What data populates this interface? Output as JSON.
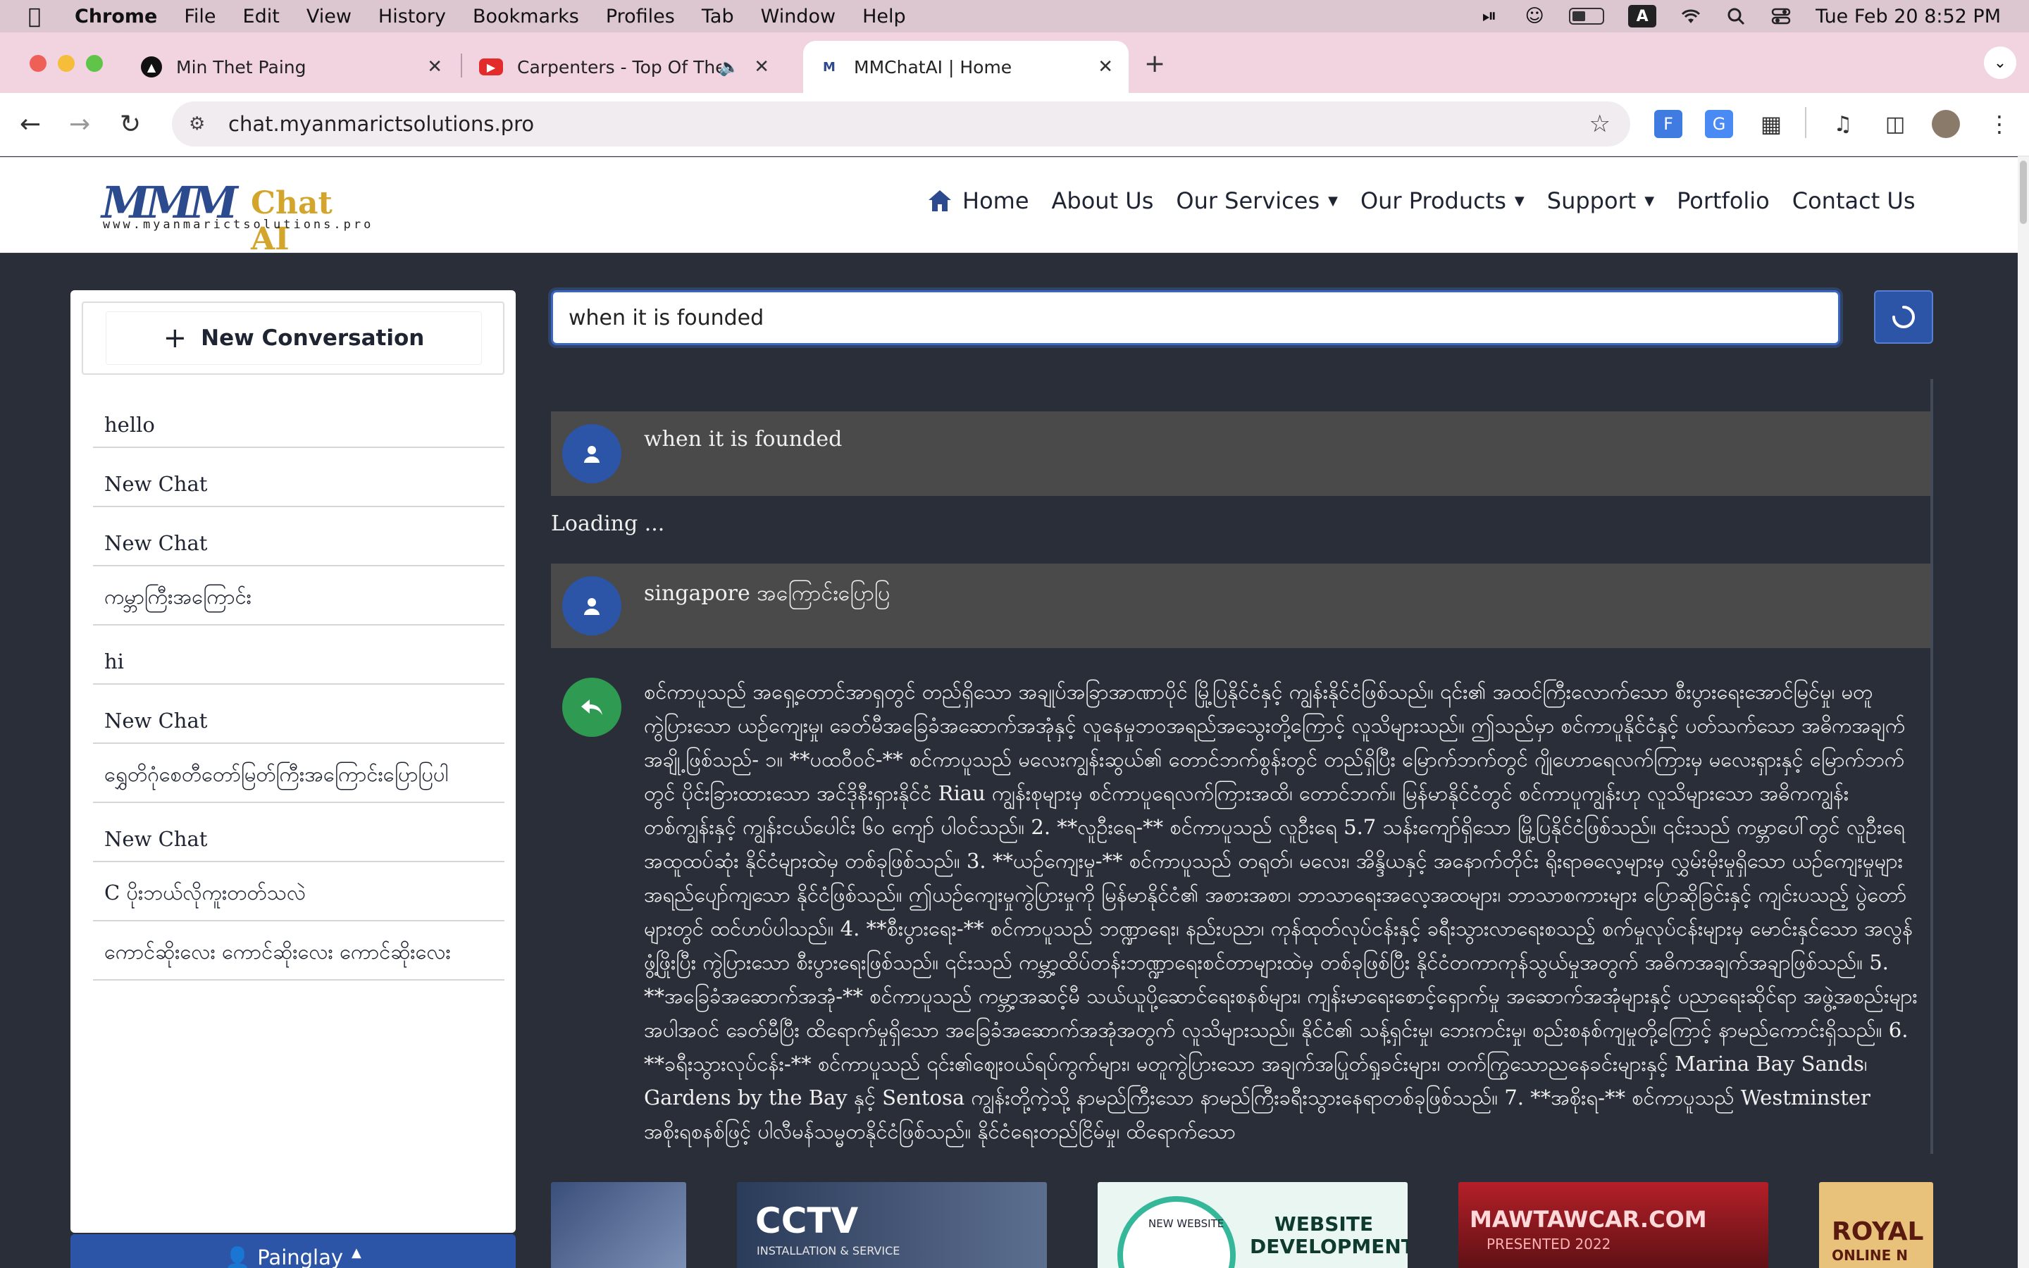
{
  "menubar": {
    "app": "Chrome",
    "items": [
      "File",
      "Edit",
      "View",
      "History",
      "Bookmarks",
      "Profiles",
      "Tab",
      "Window",
      "Help"
    ],
    "datetime": "Tue Feb 20  8:52 PM",
    "input_source": "A"
  },
  "tabs": [
    {
      "title": "Min Thet Paing"
    },
    {
      "title": "Carpenters - Top Of The W"
    },
    {
      "title": "MMChatAI | Home"
    }
  ],
  "browser": {
    "url": "chat.myanmarictsolutions.pro"
  },
  "site": {
    "logo_mark": "MMM",
    "logo_chat": "Chat AI",
    "logo_url": "www.myanmarictsolutions.pro",
    "nav": [
      {
        "label": "Home"
      },
      {
        "label": "About Us"
      },
      {
        "label": "Our Services"
      },
      {
        "label": "Our Products"
      },
      {
        "label": "Support"
      },
      {
        "label": "Portfolio"
      },
      {
        "label": "Contact Us"
      }
    ]
  },
  "sidebar": {
    "new_conversation_label": "New Conversation",
    "conversations": [
      "hello",
      "New Chat",
      "New Chat",
      "ကမ္ဘာကြီးအကြောင်း",
      "hi",
      "New Chat",
      "ရွှေတိဂုံစေတီတော်မြတ်ကြီးအကြောင်းပြောပြပါ",
      "New Chat",
      "C ပိုးဘယ်လိုကူးတတ်သလဲ",
      "ကောင်ဆိုးလေး ကောင်ဆိုးလေး ကောင်ဆိုးလေး"
    ],
    "user_name": "Painglay"
  },
  "chat": {
    "input_value": "when it is founded",
    "messages": [
      {
        "role": "user",
        "text": "when it is founded"
      },
      {
        "role": "status",
        "text": "Loading ..."
      },
      {
        "role": "user",
        "text": "singapore အကြောင်းပြောပြ"
      },
      {
        "role": "bot",
        "text": "စင်ကာပူသည် အရှေ့တောင်အာရှတွင် တည်ရှိသော အချုပ်အခြာအာဏာပိုင် မြို့ပြနိုင်ငံနှင့် ကျွန်းနိုင်ငံဖြစ်သည်။ ၎င်း၏ အထင်ကြီးလောက်သော စီးပွားရေးအောင်မြင်မှု၊ မတူကွဲပြားသော ယဉ်ကျေးမှု၊ ခေတ်မီအခြေခံအဆောက်အအုံနှင့် လူနေမှုဘဝအရည်အသွေးတို့ကြောင့် လူသိများသည်။ ဤသည်မှာ စင်ကာပူနိုင်ငံနှင့် ပတ်သက်သော အဓိကအချက်အချို့ဖြစ်သည်- ၁။ **ပထဝီဝင်-** စင်ကာပူသည် မလေးကျွန်းဆွယ်၏ တောင်ဘက်စွန်းတွင် တည်ရှိပြီး မြောက်ဘက်တွင် ဂျိုဟောရေလက်ကြားမှ မလေးရှားနှင့် မြောက်ဘက်တွင် ပိုင်းခြားထားသော အင်ဒိုနီးရှားနိုင်ငံ Riau ကျွန်းစုများမှ စင်ကာပူရေလက်ကြားအထိ၊ တောင်ဘက်။ မြန်မာနိုင်ငံတွင် စင်ကာပူကျွန်းဟု လူသိများသော အဓိကကျွန်းတစ်ကျွန်းနှင့် ကျွန်းငယ်ပေါင်း ၆၀ ကျော် ပါဝင်သည်။ 2. **လူဦးရေ-** စင်ကာပူသည် လူဦးရေ 5.7 သန်းကျော်ရှိသော မြို့ပြနိုင်ငံဖြစ်သည်။ ၎င်းသည် ကမ္ဘာပေါ်တွင် လူဦးရေ အထူထပ်ဆုံး နိုင်ငံများထဲမှ တစ်ခုဖြစ်သည်။ 3. **ယဉ်ကျေးမှု-** စင်ကာပူသည် တရုတ်၊ မလေး၊ အိန္ဒိယနှင့် အနောက်တိုင်း ရိုးရာဓလေ့များမှ လွှမ်းမိုးမှုရှိသော ယဉ်ကျေးမှုများ အရည်ပျော်ကျသော နိုင်ငံဖြစ်သည်။ ဤယဉ်ကျေးမှုကွဲပြားမှုကို မြန်မာနိုင်ငံ၏ အစားအစာ၊ ဘာသာရေးအလေ့အထများ၊ ဘာသာစကားများ ပြောဆိုခြင်းနှင့် ကျင်းပသည့် ပွဲတော်များတွင် ထင်ဟပ်ပါသည်။ 4. **စီးပွားရေး-** စင်ကာပူသည် ဘဏ္ဍာရေး၊ နည်းပညာ၊ ကုန်ထုတ်လုပ်ငန်းနှင့် ခရီးသွားလာရေးစသည့် စက်မှုလုပ်ငန်းများမှ မောင်းနှင်သော အလွန်ဖွံ့ဖြိုးပြီး ကွဲပြားသော စီးပွားရေးဖြစ်သည်။ ၎င်းသည် ကမ္ဘာ့ထိပ်တန်းဘဏ္ဍာရေးစင်တာများထဲမှ တစ်ခုဖြစ်ပြီး နိုင်ငံတကာကုန်သွယ်မှုအတွက် အဓိကအချက်အချာဖြစ်သည်။ 5. **အခြေခံအဆောက်အအုံ-** စင်ကာပူသည် ကမ္ဘာ့အဆင့်မီ သယ်ယူပို့ဆောင်ရေးစနစ်များ၊ ကျန်းမာရေးစောင့်ရှောက်မှု အဆောက်အအုံများနှင့် ပညာရေးဆိုင်ရာ အဖွဲ့အစည်းများအပါအဝင် ခေတ်မီပြီး ထိရောက်မှုရှိသော အခြေခံအဆောက်အအုံအတွက် လူသိများသည်။ နိုင်ငံ၏ သန့်ရှင်းမှု၊ ဘေးကင်းမှု၊ စည်းစနစ်ကျမှုတို့ကြောင့် နာမည်ကောင်းရှိသည်။ 6. **ခရီးသွားလုပ်ငန်း-** စင်ကာပူသည် ၎င်း၏ဈေးဝယ်ရပ်ကွက်များ၊ မတူကွဲပြားသော အချက်အပြုတ်ရှုခင်းများ၊ တက်ကြွသောညနေခင်းများနှင့် Marina Bay Sands၊ Gardens by the Bay နှင့် Sentosa ကျွန်းတို့ကဲ့သို့ နာမည်ကြီးသော နာမည်ကြီးခရီးသွားနေရာတစ်ခုဖြစ်သည်။ 7. **အစိုးရ-** စင်ကာပူသည် Westminster အစိုးရစနစ်ဖြင့် ပါလီမန်သမ္မတနိုင်ငံဖြစ်သည်။ နိုင်ငံရေးတည်ငြိမ်မှု၊ ထိရောက်သော"
      }
    ]
  },
  "banners": [
    {
      "title": ""
    },
    {
      "title": "CCTV",
      "subtitle": "INSTALLATION & SERVICE"
    },
    {
      "title": "WEBSITE DEVELOPMENT",
      "subtitle": "NEW WEBSITE"
    },
    {
      "title": "MAWTAWCAR.COM",
      "subtitle": "PRESENTED 2022"
    },
    {
      "title": "ROYAL",
      "subtitle": "ONLINE N"
    }
  ],
  "colors": {
    "accent": "#2c55a8",
    "bot_avatar": "#2f9a52",
    "logo_gold": "#d4a52d",
    "logo_blue": "#2c4a8e",
    "page_bg": "#2a2e38",
    "user_msg_bg": "#4a4a4a"
  }
}
